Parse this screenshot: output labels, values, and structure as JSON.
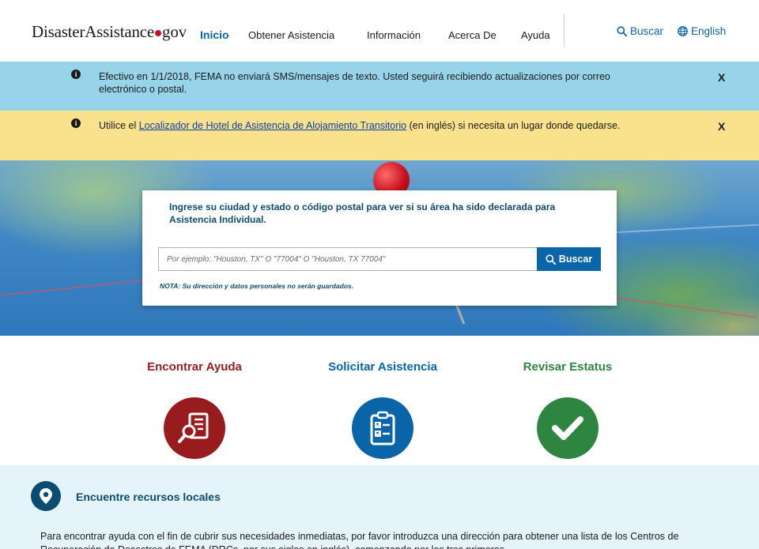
{
  "header": {
    "logo": {
      "part1": "Disaster",
      "part2": "Assistance",
      "part3": "gov"
    },
    "nav": [
      {
        "label": "Inicio",
        "active": true
      },
      {
        "label": "Obtener Asistencia",
        "active": false
      },
      {
        "label": "Información",
        "active": false
      },
      {
        "label": "Acerca De",
        "active": false
      },
      {
        "label": "Ayuda",
        "active": false
      }
    ],
    "search_link": "Buscar",
    "language_link": "English"
  },
  "alerts": [
    {
      "color": "#97d4ea",
      "text": "Efectivo en 1/1/2018, FEMA no enviará SMS/mensajes de texto. Usted seguirá recibiendo actualizaciones por correo electrónico o postal.",
      "close": "X"
    },
    {
      "color": "#fae28c",
      "text_before": "Utilice el ",
      "link_text": "Localizador de Hotel de Asistencia de Alojamiento Transitorio",
      "text_after": " (en inglés) si necesita un lugar donde quedarse.",
      "close": "X"
    }
  ],
  "search": {
    "title": "Ingrese su ciudad y estado o código postal para ver si su área ha sido declarada para Asistencia Individual.",
    "placeholder": "Por ejemplo: \"Houston, TX\" O \"77004\" O \"Houston, TX 77004\"",
    "button": "Buscar",
    "note": "NOTA: Su dirección y datos personales no serán guardados."
  },
  "actions": [
    {
      "title": "Encontrar Ayuda",
      "color": "#981b1e",
      "icon": "find-help-icon"
    },
    {
      "title": "Solicitar Asistencia",
      "color": "#0a64a8",
      "icon": "apply-checklist-icon"
    },
    {
      "title": "Revisar Estatus",
      "color": "#2e8540",
      "icon": "check-status-icon"
    }
  ],
  "local_resources": {
    "title": "Encuentre recursos locales",
    "text": "Para encontrar ayuda con el fin de cubrir sus necesidades inmediatas, por favor introduzca una dirección para obtener una lista de los Centros de Recuperación de Desastres de FEMA (DRCs, por sus siglas en inglés), comenzando por los tres primeros"
  },
  "colors": {
    "primary_blue": "#0a64a8",
    "dark_teal": "#0b4d6f",
    "red": "#981b1e",
    "green": "#2e8540"
  }
}
